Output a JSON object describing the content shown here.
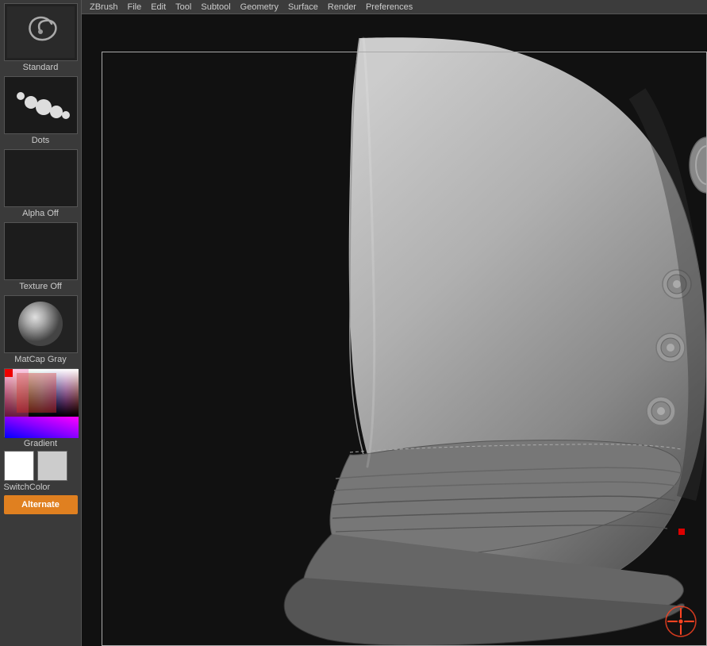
{
  "sidebar": {
    "tools": [
      {
        "id": "standard",
        "label": "Standard",
        "type": "swirl"
      },
      {
        "id": "dots",
        "label": "Dots",
        "type": "dots"
      },
      {
        "id": "alpha-off",
        "label": "Alpha Off",
        "type": "alpha"
      },
      {
        "id": "texture-off",
        "label": "Texture Off",
        "type": "texture"
      },
      {
        "id": "matcap-gray",
        "label": "MatCap Gray",
        "type": "matcap"
      }
    ],
    "color_section": {
      "label": "Gradient",
      "switch_label": "SwitchColor",
      "alternate_label": "Alternate",
      "swatch1_color": "#ffffff",
      "swatch2_color": "#cccccc"
    }
  },
  "menubar": {
    "items": [
      "ZBrush",
      "File",
      "Edit",
      "Tool",
      "Subtool",
      "Geometry",
      "Surface",
      "Render",
      "Preferences"
    ]
  },
  "viewport": {
    "background_color": "#0a0a0a"
  }
}
